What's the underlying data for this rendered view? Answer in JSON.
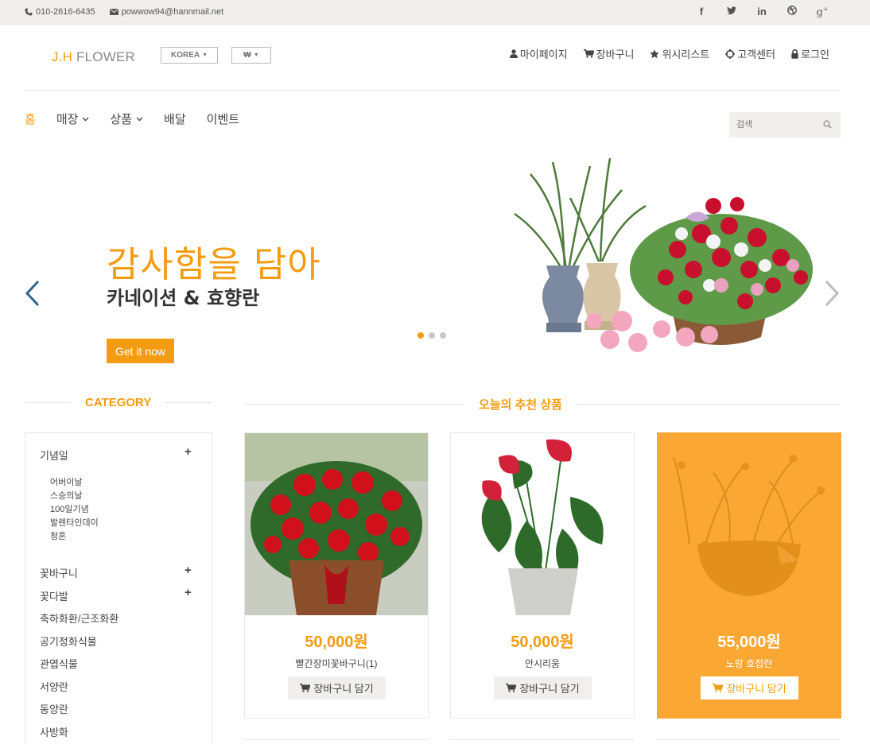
{
  "topbar": {
    "phone": "010-2616-6435",
    "email": "powwow94@hannmail.net",
    "social": [
      "facebook-icon",
      "twitter-icon",
      "linkedin-icon",
      "dribbble-icon",
      "google-plus-icon"
    ]
  },
  "header": {
    "logo_prefix": "J.H",
    "logo_text": "FLOWER",
    "country": "KOREA",
    "currency": "₩",
    "usernav": [
      "마이페이지",
      "장바구니",
      "위시리스트",
      "고객센터",
      "로그인"
    ]
  },
  "nav": {
    "items": [
      "홈",
      "매장",
      "상품",
      "배달",
      "이벤트"
    ],
    "search_placeholder": "검색"
  },
  "hero": {
    "title": "감사함을 담아",
    "subtitle": "카네이션 & 효향란",
    "button": "Get it now",
    "slide_count": 3,
    "active_slide": 1
  },
  "category": {
    "heading": "CATEGORY",
    "items": [
      {
        "label": "기념일",
        "expandable": true,
        "children": [
          "어버이날",
          "스승의날",
          "100일기념",
          "발렌타인데이",
          "청혼"
        ]
      },
      {
        "label": "꽃바구니",
        "expandable": true
      },
      {
        "label": "꽃다발",
        "expandable": true
      },
      {
        "label": "축하화환/근조화환",
        "expandable": false
      },
      {
        "label": "공기정화식물",
        "expandable": false
      },
      {
        "label": "관엽식물",
        "expandable": false
      },
      {
        "label": "서양란",
        "expandable": false
      },
      {
        "label": "동양란",
        "expandable": false
      },
      {
        "label": "사방화",
        "expandable": false
      }
    ]
  },
  "products": {
    "heading": "오늘의 추천 상품",
    "cart_label": "장바구니 담기",
    "items": [
      {
        "price": "50,000원",
        "name": "빨간장미꽃바구니(1)"
      },
      {
        "price": "50,000원",
        "name": "안시리움"
      },
      {
        "price": "55,000원",
        "name": "노랑 호접란"
      }
    ]
  },
  "colors": {
    "accent": "#f39c12",
    "highlight_card": "#fba733",
    "topbar_bg": "#f0efeb"
  }
}
